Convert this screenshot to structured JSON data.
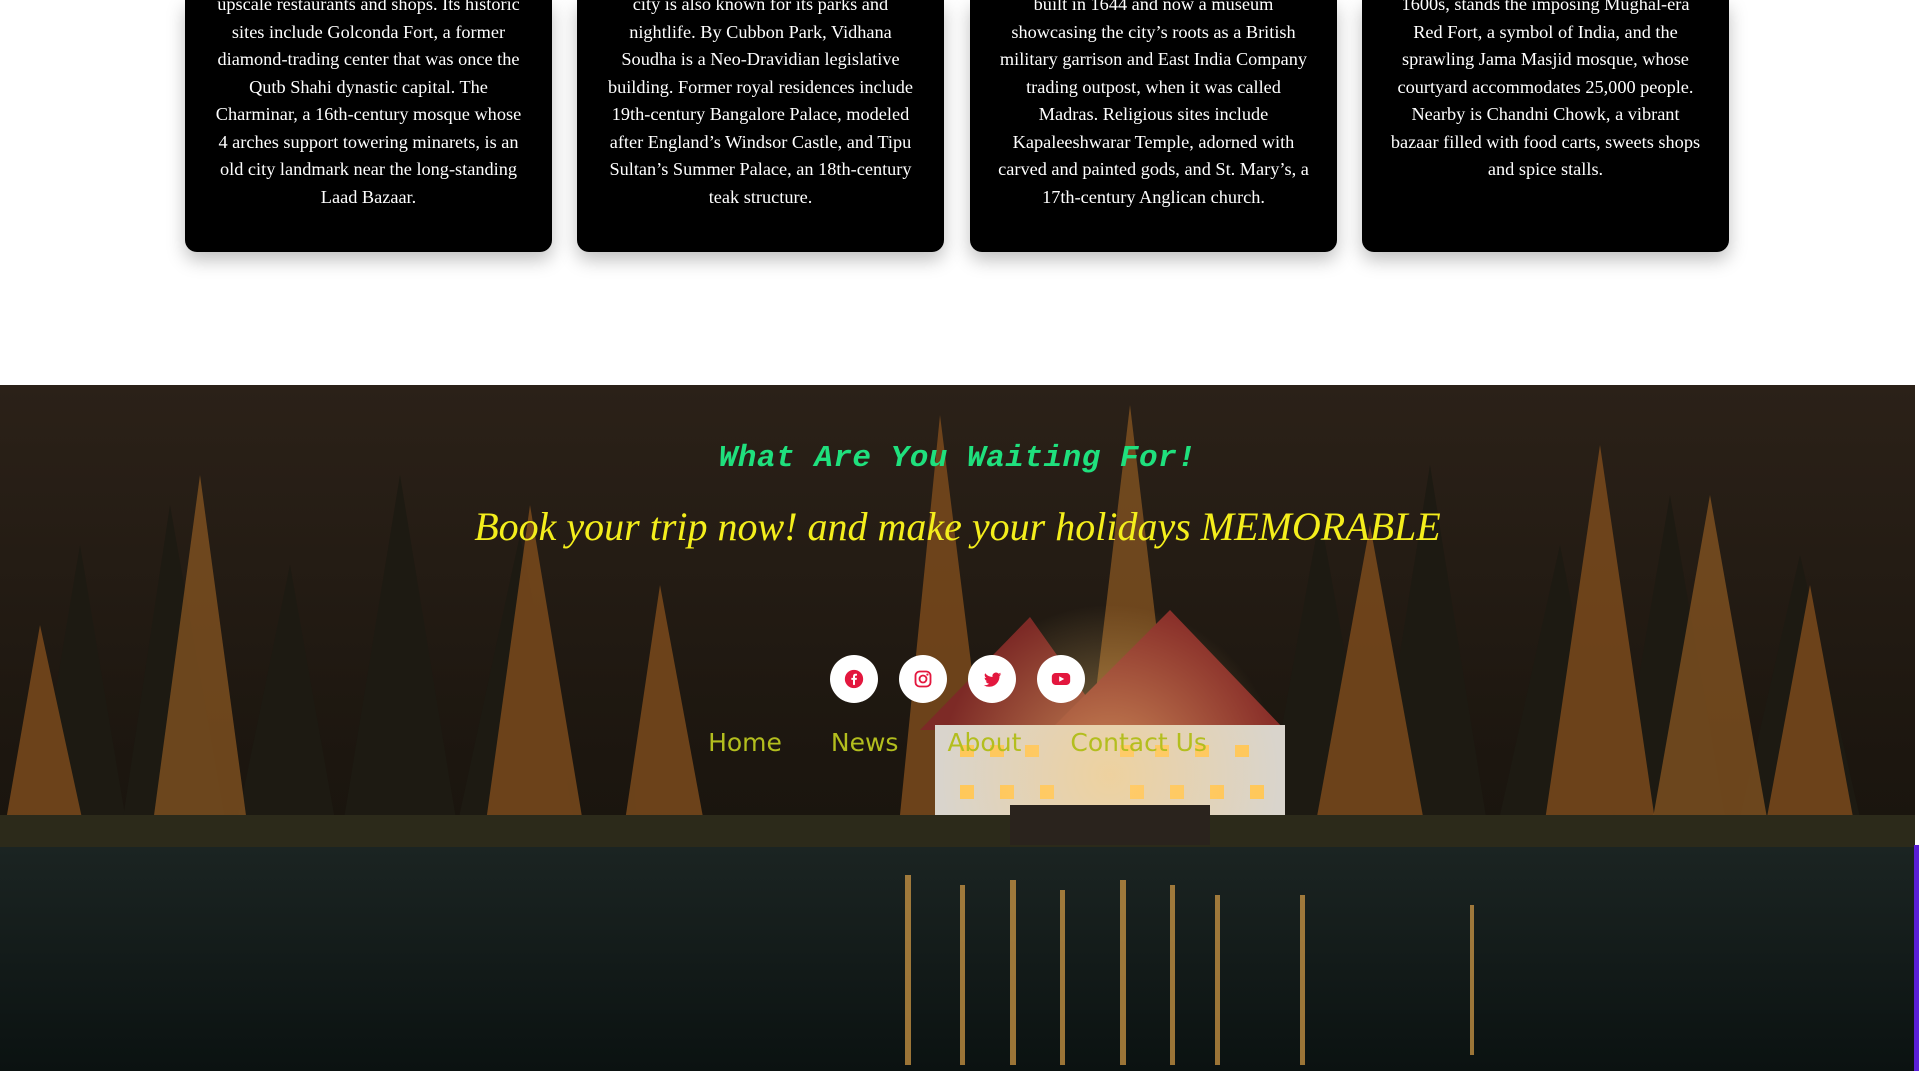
{
  "cards": [
    {
      "text": "upscale restaurants and shops. Its historic sites include Golconda Fort, a former diamond-trading center that was once the Qutb Shahi dynastic capital. The Charminar, a 16th-century mosque whose 4 arches support towering minarets, is an old city landmark near the long-standing Laad Bazaar."
    },
    {
      "text": "city is also known for its parks and nightlife. By Cubbon Park, Vidhana Soudha is a Neo-Dravidian legislative building. Former royal residences include 19th-century Bangalore Palace, modeled after England’s Windsor Castle, and Tipu Sultan’s Summer Palace, an 18th-century teak structure."
    },
    {
      "text": "built in 1644 and now a museum showcasing the city’s roots as a British military garrison and East India Company trading outpost, when it was called Madras. Religious sites include Kapaleeshwarar Temple, adorned with carved and painted gods, and St. Mary’s, a 17th-century Anglican church."
    },
    {
      "text": "1600s, stands the imposing Mughal-era Red Fort, a symbol of India, and the sprawling Jama Masjid mosque, whose courtyard accommodates 25,000 people. Nearby is Chandni Chowk, a vibrant bazaar filled with food carts, sweets shops and spice stalls."
    }
  ],
  "hero": {
    "kicker": "What Are You Waiting For!",
    "headline": "Book your trip now! and make your holidays MEMORABLE"
  },
  "social": [
    {
      "name": "facebook-icon",
      "color": "#e3173e"
    },
    {
      "name": "instagram-icon",
      "color": "#e3173e"
    },
    {
      "name": "twitter-icon",
      "color": "#e3173e"
    },
    {
      "name": "youtube-icon",
      "color": "#e3173e"
    }
  ],
  "nav": {
    "items": [
      "Home",
      "News",
      "About",
      "Contact Us"
    ]
  },
  "colors": {
    "kicker": "#1fe07d",
    "headline": "#f4ee1c",
    "nav": "#b3be1e",
    "card_bg": "#000000",
    "social_icon": "#e3173e"
  }
}
